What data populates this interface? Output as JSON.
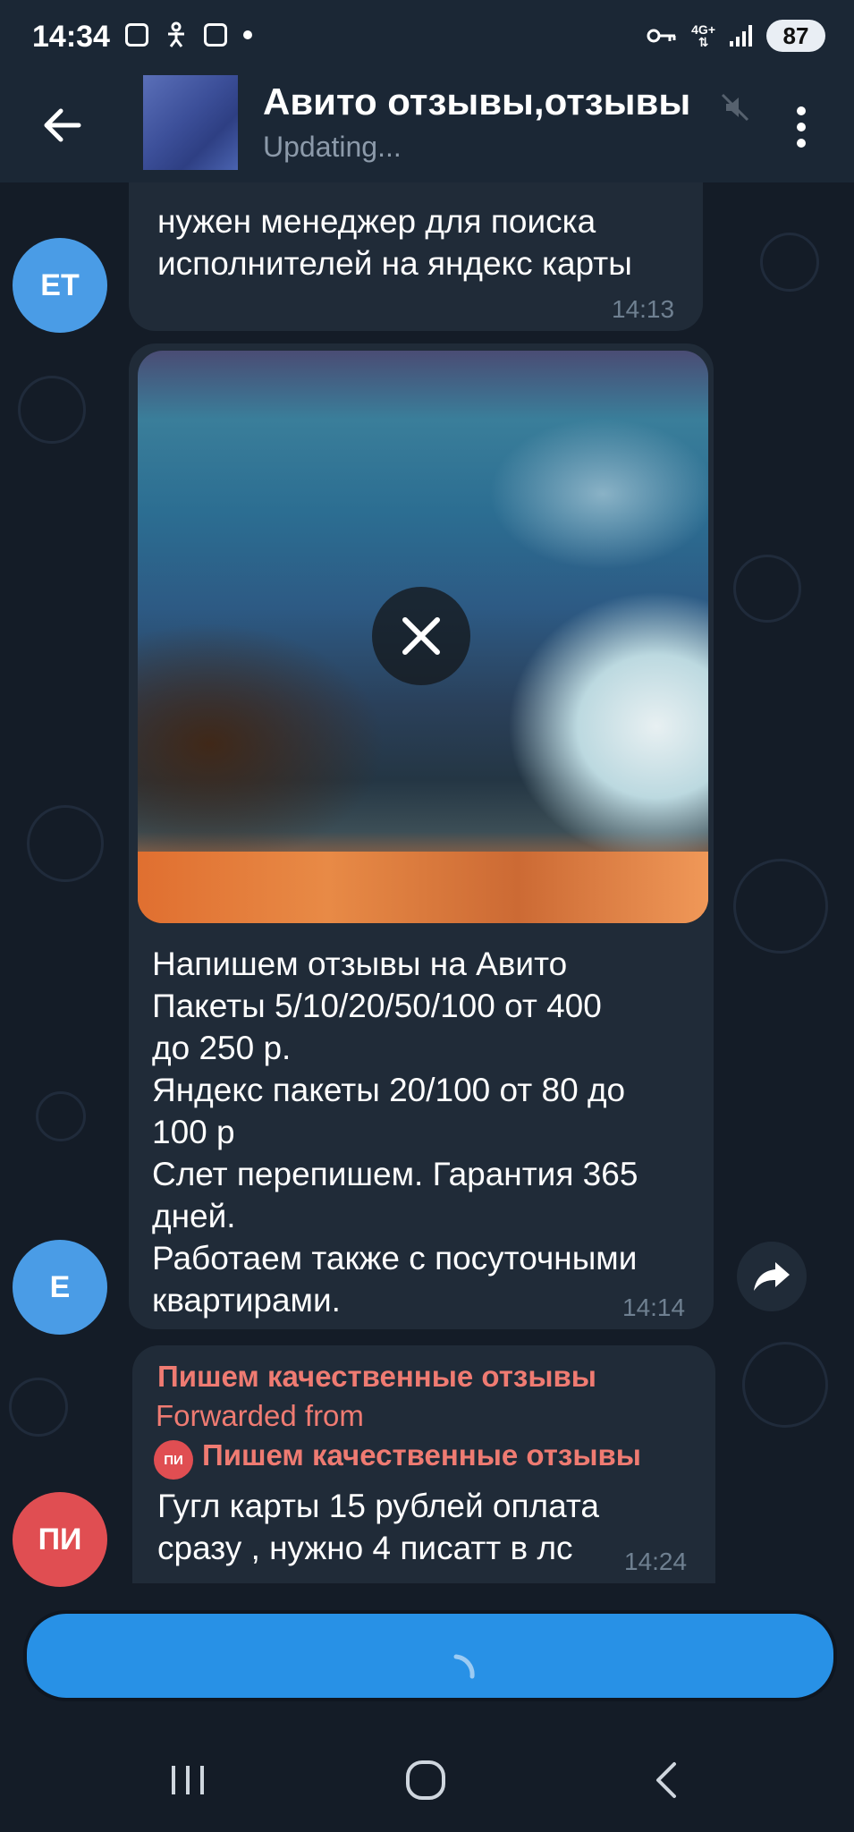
{
  "status_bar": {
    "time": "14:34",
    "network": "4G+",
    "battery": "87"
  },
  "header": {
    "title": "Авито отзывы,отзывы",
    "subtitle": "Updating..."
  },
  "messages": [
    {
      "avatar_initials": "ET",
      "avatar_color": "#4a9ce6",
      "text": "нужен менеджер для поиска\nисполнителей на яндекс карты",
      "time": "14:13"
    },
    {
      "avatar_initials": "E",
      "avatar_color": "#4a9ce6",
      "text": "Напишем отзывы на Авито\nПакеты 5/10/20/50/100  от 400\nдо 250 р.\n Яндекс пакеты 20/100 от 80 до\n100 р\nСлет перепишем. Гарантия 365\nдней.\nРаботаем также с посуточными\nквартирами.",
      "time": "14:14"
    },
    {
      "avatar_initials": "ПИ",
      "avatar_color": "#e04e52",
      "sender_name": "Пишем качественные отзывы",
      "forwarded_label": "Forwarded from",
      "forwarded_channel_initials": "ПИ",
      "forwarded_channel": "Пишем качественные отзывы",
      "text": "Гугл карты 15 рублей оплата\nсразу , нужно 4 писатт в лс",
      "time": "14:24"
    }
  ],
  "colors": {
    "accent": "#2891e6",
    "bubble": "#202b38",
    "forwarded": "#ef7b72",
    "background": "#141c27"
  }
}
